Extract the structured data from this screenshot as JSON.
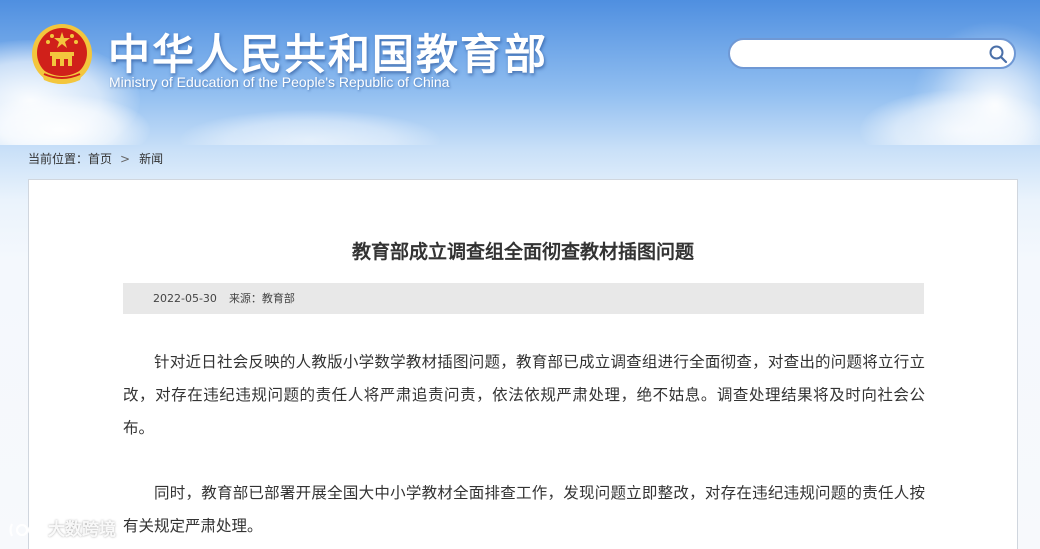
{
  "header": {
    "site_title": "中华人民共和国教育部",
    "site_subtitle": "Ministry of Education of the People's Republic of China",
    "search": {
      "value": "",
      "placeholder": ""
    }
  },
  "breadcrumb": {
    "prefix": "当前位置：",
    "items": [
      "首页",
      "新闻"
    ],
    "separator": ">"
  },
  "article": {
    "title": "教育部成立调查组全面彻查教材插图问题",
    "date": "2022-05-30",
    "source": "来源：教育部",
    "paragraphs": [
      "针对近日社会反映的人教版小学数学教材插图问题，教育部已成立调查组进行全面彻查，对查出的问题将立行立改，对存在违纪违规问题的责任人将严肃追责问责，依法依规严肃处理，绝不姑息。调查处理结果将及时向社会公布。",
      "同时，教育部已部署开展全国大中小学教材全面排查工作，发现问题立即整改，对存在违纪违规问题的责任人按有关规定严肃处理。"
    ]
  },
  "watermark": {
    "text": "大数跨境"
  },
  "colors": {
    "sky_top": "#4f8fe0",
    "search_border": "#6f98d4",
    "meta_bar": "#e8e8e8",
    "emblem_red": "#d0201a",
    "emblem_gold": "#f3c63d"
  },
  "icons": [
    "national-emblem-icon",
    "search-icon",
    "chevron-right-icon",
    "watermark-logo-icon"
  ]
}
